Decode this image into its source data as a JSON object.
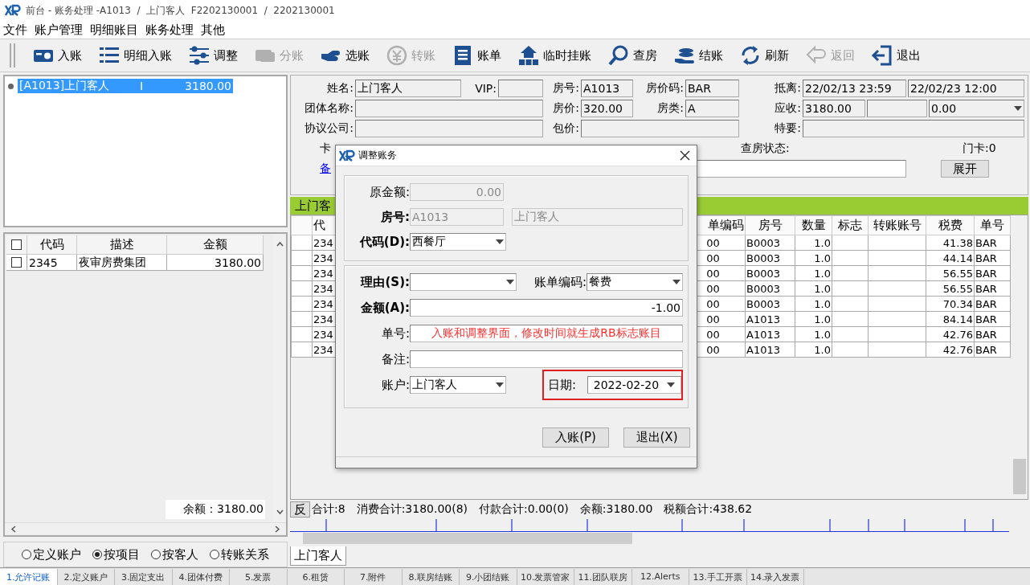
{
  "window": {
    "title": "前台 - 账务处理 -A1013  /  上门客人  F2202130001  /  2202130001"
  },
  "menu": [
    "文件",
    "账户管理",
    "明细账目",
    "账务处理",
    "其他"
  ],
  "toolbar": [
    {
      "label": "入账",
      "disabled": false
    },
    {
      "label": "明细入账",
      "disabled": false
    },
    {
      "label": "调整",
      "disabled": false
    },
    {
      "label": "分账",
      "disabled": true
    },
    {
      "label": "选账",
      "disabled": false
    },
    {
      "label": "转账",
      "disabled": true
    },
    {
      "label": "账单",
      "disabled": false
    },
    {
      "label": "临时挂账",
      "disabled": false
    },
    {
      "label": "查房",
      "disabled": false
    },
    {
      "label": "结账",
      "disabled": false
    },
    {
      "label": "刷新",
      "disabled": false
    },
    {
      "label": "返回",
      "disabled": true
    },
    {
      "label": "退出",
      "disabled": false
    }
  ],
  "guest_list": [
    {
      "name": "[A1013]上门客人",
      "flag": "I",
      "amount": "3180.00",
      "selected": true
    }
  ],
  "items_table": {
    "header_checked": false,
    "columns": [
      "代码",
      "描述",
      "金额"
    ],
    "rows": [
      {
        "checked": false,
        "code": "2345",
        "description": "夜审房费集团",
        "amount": "3180.00"
      }
    ],
    "balance": "余额：3180.00"
  },
  "view_options": [
    {
      "label": "定义账户",
      "selected": false
    },
    {
      "label": "按项目",
      "selected": true
    },
    {
      "label": "按客人",
      "selected": false
    },
    {
      "label": "转账关系",
      "selected": false
    }
  ],
  "info": {
    "fields": [
      {
        "label": "姓名:",
        "value": "上门客人",
        "kind": "field"
      },
      {
        "label": "VIP:",
        "kind": "field"
      },
      {
        "label": "房号:",
        "value": "A1013",
        "kind": "field"
      },
      {
        "label": "房价码:",
        "value": "BAR",
        "kind": "field"
      },
      {
        "label": "抵离:",
        "value": "22/02/13 23:59",
        "kind": "field"
      },
      {
        "value": "22/02/23 12:00",
        "kind": "field"
      },
      {
        "label": "团体名称:",
        "kind": "field"
      },
      {
        "label": "房价:",
        "value": "320.00",
        "kind": "field"
      },
      {
        "label": "房类:",
        "value": "A",
        "kind": "field"
      },
      {
        "label": "应收:",
        "value": "3180.00",
        "kind": "field"
      },
      {
        "kind": "field"
      },
      {
        "value": "0.00",
        "kind": "combo"
      },
      {
        "label": "协议公司:",
        "kind": "field"
      },
      {
        "label": "包价:",
        "kind": "field"
      },
      {
        "label": "特要:",
        "kind": "field"
      }
    ],
    "card_label": "卡",
    "checkin_label": "查房状态:",
    "door_card": "门卡:0",
    "remark_link": "备",
    "expand_button": "展开"
  },
  "detail": {
    "header": "上门客",
    "columns": [
      "代",
      "单编码",
      "房号",
      "数量",
      "标志",
      "转账账号",
      "税费",
      "单号"
    ],
    "rows": [
      {
        "code": "234",
        "bill_code": "00",
        "room": "B0003",
        "qty": "1.0",
        "tax": "41.38",
        "ref": "BAR"
      },
      {
        "code": "234",
        "bill_code": "00",
        "room": "B0003",
        "qty": "1.0",
        "tax": "44.14",
        "ref": "BAR"
      },
      {
        "code": "234",
        "bill_code": "00",
        "room": "B0003",
        "qty": "1.0",
        "tax": "56.55",
        "ref": "BAR"
      },
      {
        "code": "234",
        "bill_code": "00",
        "room": "B0003",
        "qty": "1.0",
        "tax": "56.55",
        "ref": "BAR"
      },
      {
        "code": "234",
        "bill_code": "00",
        "room": "B0003",
        "qty": "1.0",
        "tax": "70.34",
        "ref": "BAR"
      },
      {
        "code": "234",
        "bill_code": "00",
        "room": "A1013",
        "qty": "1.0",
        "tax": "84.14",
        "ref": "BAR"
      },
      {
        "code": "234",
        "bill_code": "00",
        "room": "A1013",
        "qty": "1.0",
        "tax": "42.76",
        "ref": "BAR"
      },
      {
        "code": "234",
        "bill_code": "00",
        "room": "A1013",
        "qty": "1.0",
        "tax": "42.76",
        "ref": "BAR"
      }
    ]
  },
  "summary": {
    "button": "反",
    "items": [
      "合计:8",
      "消费合计:3180.00(8)",
      "付款合计:0.00(0)",
      "余额:3180.00",
      "税额合计:438.62"
    ]
  },
  "detail_tab": "上门客人",
  "bottom_tabs": [
    {
      "label": "1.允许记账",
      "selected": true
    },
    {
      "label": "2.定义账户",
      "selected": false
    },
    {
      "label": "3.固定支出",
      "selected": false
    },
    {
      "label": "4.团体付费",
      "selected": false
    },
    {
      "label": "5.发票",
      "selected": false
    },
    {
      "label": "6.租赁",
      "selected": false
    },
    {
      "label": "7.附件",
      "selected": false
    },
    {
      "label": "8.联房结账",
      "selected": false
    },
    {
      "label": "9.小团结账",
      "selected": false
    },
    {
      "label": "10.发票管家",
      "selected": false
    },
    {
      "label": "11.团队联房",
      "selected": false
    },
    {
      "label": "12.Alerts",
      "selected": false
    },
    {
      "label": "13.手工开票",
      "selected": false
    },
    {
      "label": "14.录入发票",
      "selected": false
    }
  ],
  "dialog": {
    "title": "调整账务",
    "original_amount": {
      "label": "原金额:",
      "value": "0.00",
      "disabled": true,
      "required": false
    },
    "room": {
      "label": "房号:",
      "value": "A1013",
      "guest": "上门客人",
      "disabled": true,
      "required": true
    },
    "code": {
      "label": "代码(D):",
      "value": "西餐厅",
      "required": true
    },
    "reason": {
      "label": "理由(S):",
      "required": true
    },
    "bill_code": {
      "label": "账单编码:",
      "value": "餐费"
    },
    "amount": {
      "label": "金额(A):",
      "value": "-1.00",
      "required": true
    },
    "ref_no": {
      "label": "单号:",
      "value": "入账和调整界面，修改时间就生成RB标志账目",
      "required": false
    },
    "remark": {
      "label": "备注:",
      "required": false
    },
    "account": {
      "label": "账户:",
      "value": "上门客人",
      "required": false
    },
    "date": {
      "label": "日期:",
      "value": "2022-02-20",
      "highlighted": true
    },
    "buttons": [
      "入账(P)",
      "退出(X)"
    ]
  }
}
